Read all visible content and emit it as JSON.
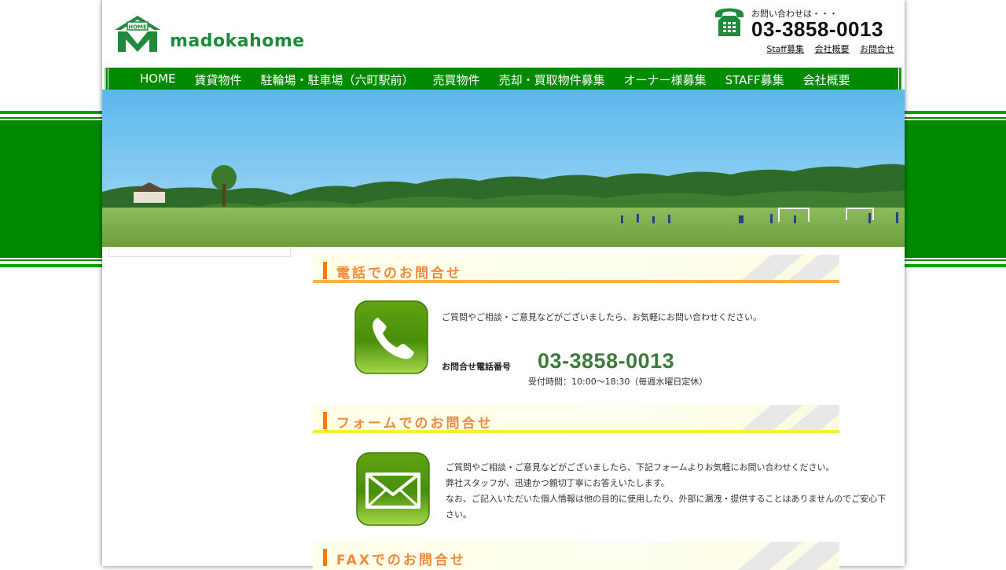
{
  "header": {
    "logo_text": "HOME",
    "brand": "madokahome",
    "tel_prompt": "お問い合わせは・・・",
    "tel_number": "03-3858-0013",
    "util_links": [
      "Staff募集",
      "会社概要",
      "お問合せ"
    ]
  },
  "nav": {
    "items": [
      "HOME",
      "賃貸物件",
      "駐輪場・駐車場（六町駅前）",
      "売買物件",
      "売却・買取物件募集",
      "オーナー様募集",
      "STAFF募集",
      "会社概要"
    ]
  },
  "sections": {
    "phone": {
      "title": "電話でのお問合せ",
      "intro": "ご質問やご相談・ご意見などがございましたら、お気軽にお問い合わせください。",
      "tel_label": "お問合せ電話番号",
      "tel_number": "03-3858-0013",
      "hours": "受付時間：10:00～18:30（毎週水曜日定休）"
    },
    "form": {
      "title": "フォームでのお問合せ",
      "line1": "ご質問やご相談・ご意見などがございましたら、下記フォームよりお気軽にお問い合わせください。",
      "line2": "弊社スタッフが、迅速かつ親切丁寧にお答えいたします。",
      "line3": "なお、ご記入いただいた個人情報は他の目的に使用したり、外部に漏洩・提供することはありませんのでご安心下",
      "line4": "さい。"
    },
    "fax": {
      "title": "FAXでのお問合せ"
    }
  },
  "colors": {
    "brand_green": "#008a00",
    "accent_orange": "#ff7a00",
    "heading_orange": "#f08a3a"
  },
  "icons": [
    "phone-handset-icon",
    "phone-button-icon",
    "mail-button-icon",
    "home-logo-icon"
  ]
}
